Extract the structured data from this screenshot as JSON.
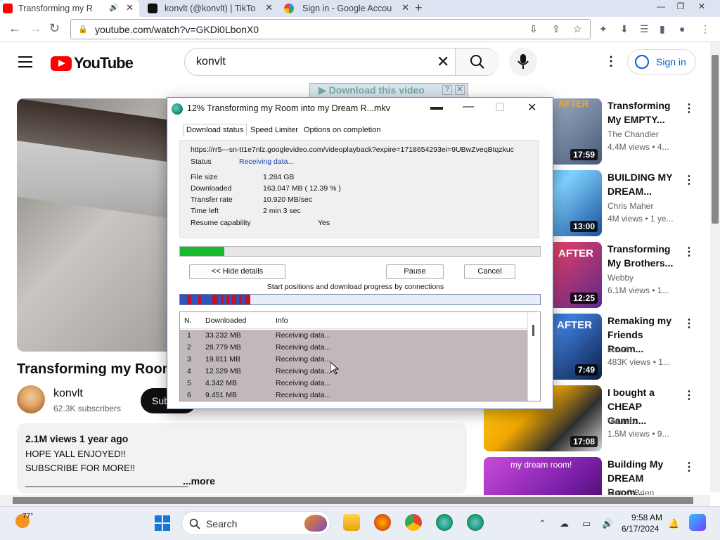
{
  "browser": {
    "tabs": [
      {
        "label": "Transforming my R"
      },
      {
        "label": "konvlt (@konvlt) | TikTo"
      },
      {
        "label": "Sign in - Google Accou"
      }
    ],
    "url": "youtube.com/watch?v=GKDi0LbonX0"
  },
  "youtube": {
    "logo": "YouTube",
    "search_query": "konvlt",
    "signin": "Sign in",
    "video_title": "Transforming my Room",
    "channel": {
      "name": "konvlt",
      "subscribers": "62.3K subscribers"
    },
    "subscribe_label": "Sub",
    "description": {
      "meta": "2.1M views  1 year ago",
      "line1": "HOPE YALL ENJOYED!!",
      "line2": "SUBSCRIBE FOR MORE!!",
      "line3": "________________________________",
      "more": "...more"
    },
    "download_banner": "Download this video",
    "related": [
      {
        "title": "Transforming My EMPTY...",
        "channel": "The Chandler",
        "views": "4.4M views  •  4...",
        "duration": "17:59",
        "tag": "AFTER"
      },
      {
        "title": "BUILDING MY DREAM...",
        "channel": "Chris Maher",
        "views": "4M views  •  1 ye...",
        "duration": "13:00",
        "tag": ""
      },
      {
        "title": "Transforming My Brothers...",
        "channel": "Webby",
        "views": "6.1M views  •  1...",
        "duration": "12:25",
        "tag": "AFTER"
      },
      {
        "title": "Remaking my Friends Room...",
        "channel": "konvlt",
        "views": "483K views  •  1...",
        "duration": "7:49",
        "tag": "AFTER"
      },
      {
        "title": "I bought a CHEAP Gamin...",
        "channel": "Vermax",
        "views": "1.5M views  •  9...",
        "duration": "17:08",
        "tag": ""
      },
      {
        "title": "Building My DREAM Room...",
        "channel": "Matt O'Brien",
        "views": "",
        "duration": "",
        "tag": "my dream room!"
      }
    ]
  },
  "idm": {
    "title": "12% Transforming my Room into my Dream R...mkv",
    "tabs": [
      "Download status",
      "Speed Limiter",
      "Options on completion"
    ],
    "url_line": "https://rr5---sn-tt1e7nlz.googlevideo.com/videoplayback?expire=1718654293ei=9UBwZveqBtqzkuc",
    "status_label": "Status",
    "status_value": "Receiving data...",
    "file_size_label": "File size",
    "file_size": "1.284  GB",
    "downloaded_label": "Downloaded",
    "downloaded": "163.047  MB  ( 12.39 % )",
    "rate_label": "Transfer rate",
    "rate": "10.920  MB/sec",
    "time_left_label": "Time left",
    "time_left": "2 min 3 sec",
    "resume_label": "Resume capability",
    "resume": "Yes",
    "progress_fraction": 0.1239,
    "hide_details": "<< Hide details",
    "pause": "Pause",
    "cancel": "Cancel",
    "connections_label": "Start positions and download progress by connections",
    "columns": [
      "N.",
      "Downloaded",
      "Info"
    ],
    "rows": [
      {
        "n": "1",
        "downloaded": "33.232  MB",
        "info": "Receiving data..."
      },
      {
        "n": "2",
        "downloaded": "28.779  MB",
        "info": "Receiving data..."
      },
      {
        "n": "3",
        "downloaded": "19.811  MB",
        "info": "Receiving data..."
      },
      {
        "n": "4",
        "downloaded": "12.529  MB",
        "info": "Receiving data..."
      },
      {
        "n": "5",
        "downloaded": "4.342  MB",
        "info": "Receiving data..."
      },
      {
        "n": "6",
        "downloaded": "9.451  MB",
        "info": "Receiving data..."
      }
    ]
  },
  "taskbar": {
    "temperature": "77°",
    "search": "Search",
    "time": "9:58 AM",
    "date": "6/17/2024"
  },
  "colors": {
    "youtube_red": "#ff0000",
    "progress_green": "#19b92d",
    "link_blue": "#065fd4"
  }
}
